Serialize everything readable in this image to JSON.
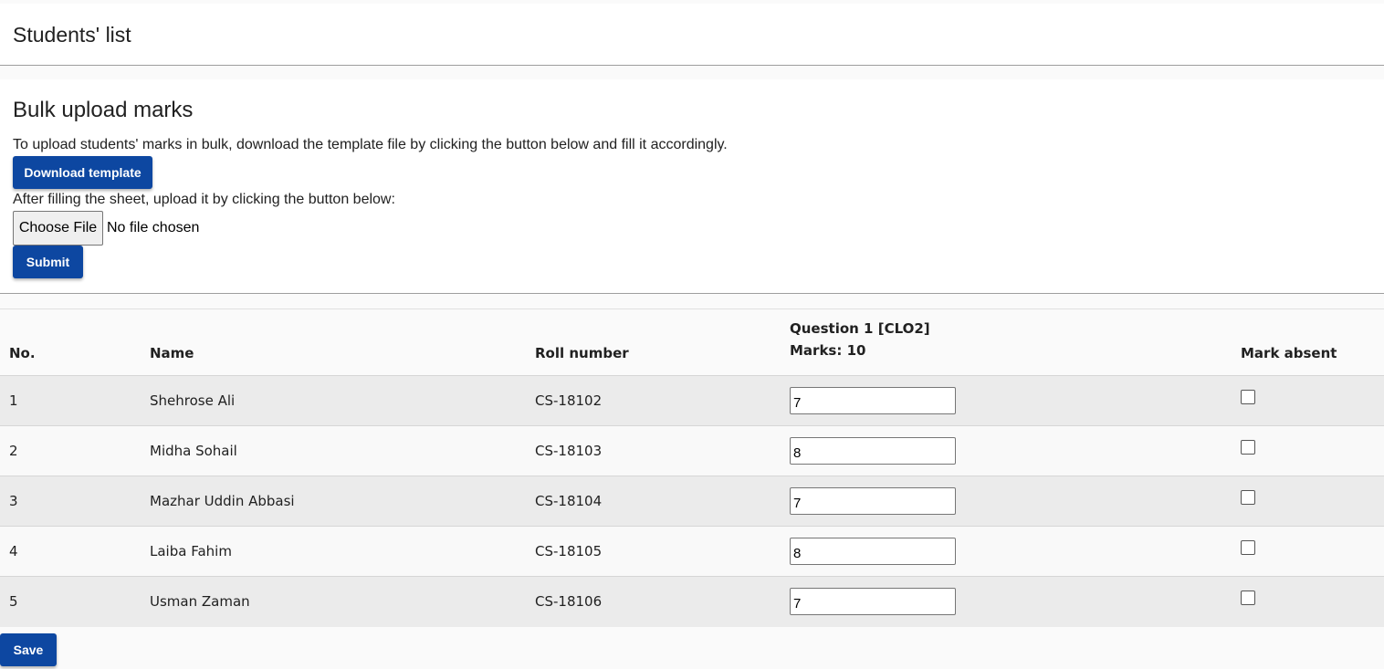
{
  "header": {
    "title": "Students' list"
  },
  "bulk_upload": {
    "title": "Bulk upload marks",
    "instruction": "To upload students' marks in bulk, download the template file by clicking the button below and fill it accordingly.",
    "download_label": "Download template",
    "upload_instruction": "After filling the sheet, upload it by clicking the button below:",
    "choose_file_label": "Choose File",
    "file_status": "No file chosen",
    "submit_label": "Submit"
  },
  "table": {
    "headers": {
      "no": "No.",
      "name": "Name",
      "roll": "Roll number",
      "question": "Question 1 [CLO2]",
      "marks": "Marks: 10",
      "absent": "Mark absent"
    },
    "rows": [
      {
        "no": "1",
        "name": "Shehrose Ali",
        "roll": "CS-18102",
        "mark": "7",
        "absent": false
      },
      {
        "no": "2",
        "name": "Midha Sohail",
        "roll": "CS-18103",
        "mark": "8",
        "absent": false
      },
      {
        "no": "3",
        "name": "Mazhar Uddin Abbasi",
        "roll": "CS-18104",
        "mark": "7",
        "absent": false
      },
      {
        "no": "4",
        "name": "Laiba Fahim",
        "roll": "CS-18105",
        "mark": "8",
        "absent": false
      },
      {
        "no": "5",
        "name": "Usman Zaman",
        "roll": "CS-18106",
        "mark": "7",
        "absent": false
      }
    ]
  },
  "save_label": "Save",
  "colors": {
    "primary_button": "#0d47a1"
  }
}
